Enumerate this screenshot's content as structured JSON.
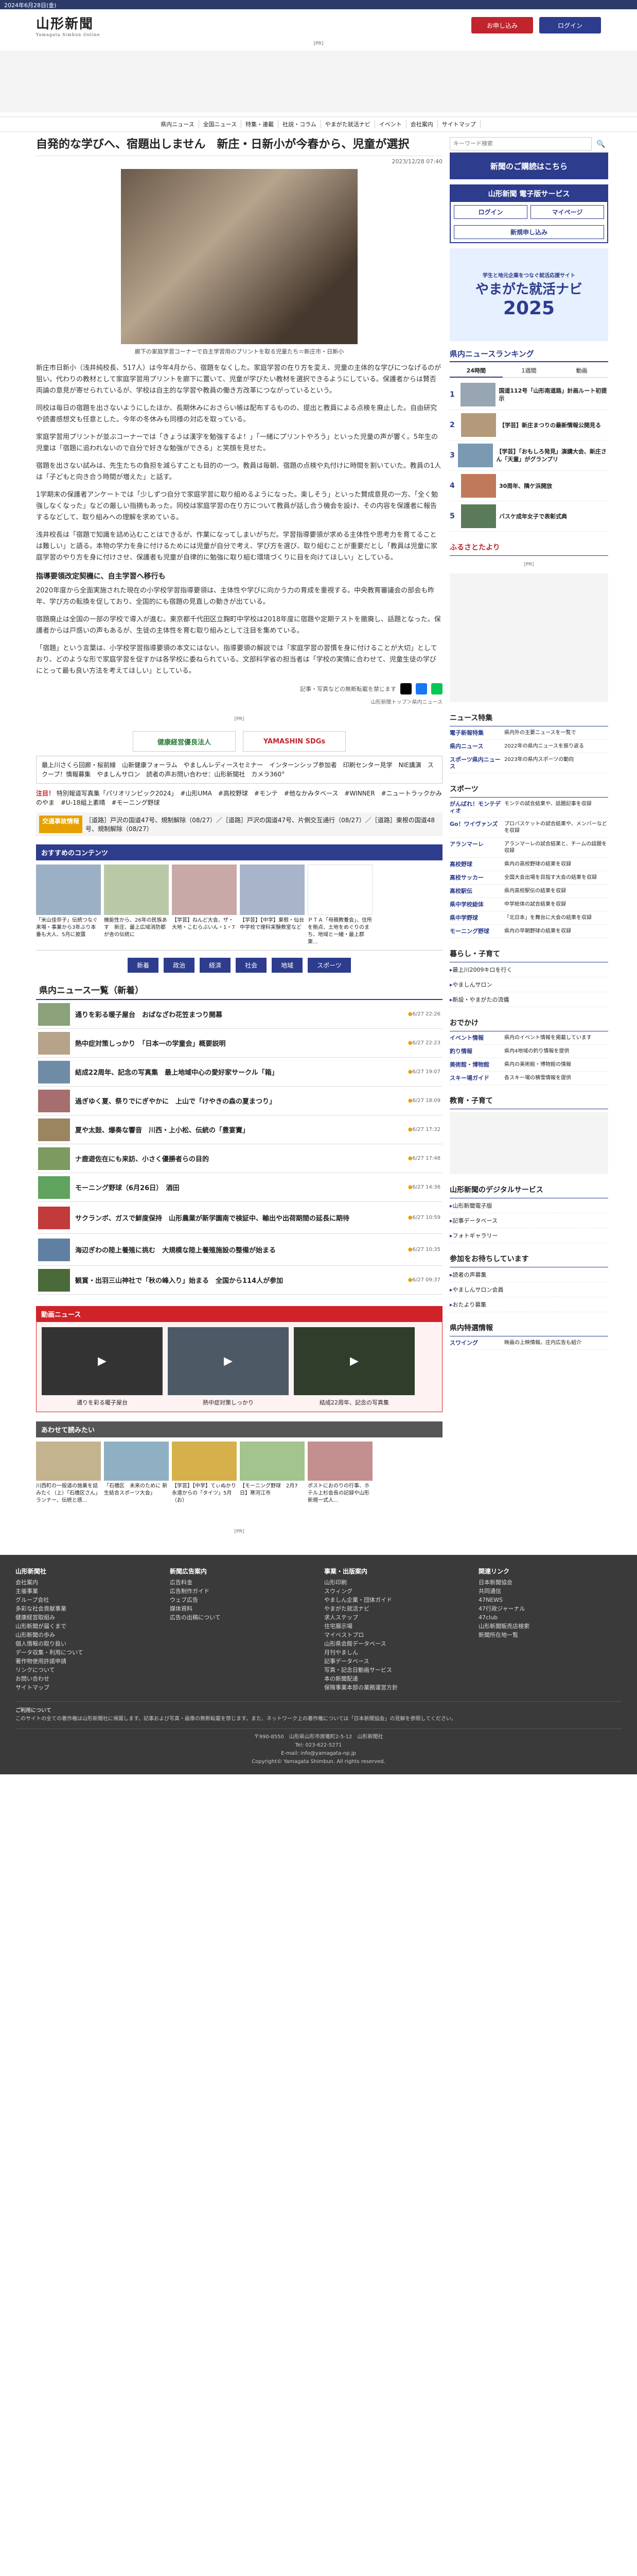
{
  "datebar": "2024年6月28日(金)",
  "header": {
    "logo": "山形新聞",
    "logo_sub": "Yamagata Simbun Online",
    "apply": "お申し込み",
    "login": "ログイン"
  },
  "pr": "[PR]",
  "gnav": [
    "県内ニュース",
    "全国ニュース",
    "特集・連載",
    "社説・コラム",
    "やまがた就活ナビ",
    "イベント",
    "会社案内",
    "サイトマップ"
  ],
  "article": {
    "title": "自発的な学びへ、宿題出しません　新庄・日新小が今春から、児童が選択",
    "date": "2023/12/28 07:40",
    "caption": "廊下の家庭学習コーナーで自主学習用のプリントを取る児童たち＝新庄市・日新小",
    "paragraphs": [
      "新庄市日新小（浅井純校長、517人）は今年4月から、宿題をなくした。家庭学習の在り方を変え、児童の主体的な学びにつなげるのが狙い。代わりの教材として家庭学習用プリントを廊下に置いて、児童が学びたい教材を選択できるようにしている。保護者からは賛否両論の意見が寄せられているが、学校は自主的な学習や教員の働き方改革につながっているという。",
      "同校は毎日の宿題を出さないようにしたほか、長期休みにおさらい帳は配布するものの、提出と教員による点検を廃止した。自由研究や読書感想文も任意とした。今年の冬休みも同様の対応を取っている。",
      "家庭学習用プリントが並ぶコーナーでは「きょうは漢字を勉強するよ！」「一緒にプリントやろう」といった児童の声が響く。5年生の児童は「宿題に追われないので自分で好きな勉強ができる」と笑顔を見せた。",
      "宿題を出さない試みは、先生たちの負担を減らすことも目的の一つ。教員は毎朝、宿題の点検や丸付けに時間を割いていた。教員の1人は「子どもと向き合う時間が増えた」と話す。",
      "1学期末の保護者アンケートでは「少しずつ自分で家庭学習に取り組めるようになった。楽しそう」といった賛成意見の一方、「全く勉強しなくなった」などの厳しい指摘もあった。同校は家庭学習の在り方について教員が話し合う機会を設け、その内容を保護者に報告するなどして、取り組みへの理解を求めている。",
      "浅井校長は「宿題で知識を詰め込むことはできるが、作業になってしまいがちだ。学習指導要領が求める主体性や思考力を育てることは難しい」と語る。本物の学力を身に付けるためには児童が自分で考え、学び方を選び、取り組むことが重要だとし「教員は児童に家庭学習のやり方を身に付けさせ、保護者も児童が自律的に勉強に取り組む環境づくりに目を向けてほしい」としている。"
    ],
    "subhead": "指導要領改定契機に、自主学習へ移行も",
    "paragraphs2": [
      "2020年度から全面実施された現在の小学校学習指導要領は、主体性や学びに向かう力の育成を重視する。中央教育審議会の部会も昨年、学び方の転換を促しており、全国的にも宿題の見直しの動きが出ている。",
      "宿題廃止は全国の一部の学校で導入が進む。東京都千代田区立麹町中学校は2018年度に宿題や定期テストを撤廃し、話題となった。保護者からは戸惑いの声もあるが、生徒の主体性を育む取り組みとして注目を集めている。",
      "「宿題」という言葉は、小学校学習指導要領の本文にはない。指導要領の解説では「家庭学習の習慣を身に付けることが大切」としており、どのような形で家庭学習を促すかは各学校に委ねられている。文部科学省の担当者は「学校の実情に合わせて、児童生徒の学びにとって最も良い方法を考えてほしい」としている。"
    ],
    "share_note": "記事・写真などの無断転載を禁じます",
    "breadcrumb": "山形新聞トップ＞県内ニュース"
  },
  "sponsors": [
    "健康経営優良法人",
    "YAMASHIN SDGs"
  ],
  "related": "最上川さくら回廊・桜前線　山新健康フォーラム　やましんレディースセミナー　インターンシップ参加者　印刷センター見学　NIE講演　スクープ！情報募集　やましんサロン　読者の声お問い合わせ：山形新聞社　カメラ360°",
  "notice": {
    "label": "注目！",
    "text": "特別報道写真集「パリオリンピック2024」　#山形UMA　#高校野球　#モンテ　#他なかみタベース　#WINNER　#ニュートラックかみのやま　#U-18組上素晴　#モーニング野球"
  },
  "ticker": {
    "tag": "交通事故情報",
    "text": "［道路］戸沢の国道47号、規制解除（08/27）／［道路］戸沢の国道47号、片側交互通行（08/27）／［道路］東根の国道48号、規制解除（08/27）"
  },
  "recs_head": "おすすめのコンテンツ",
  "recs": [
    {
      "title": "「米山佳奈子」伝統つなぐ来場・事業から3年ぶり本番も大人、5月に披露"
    },
    {
      "title": "機能性から、26年の民族あす　新庄、最上広域消防都が舎の伝統に"
    },
    {
      "title": "【学芸】ねんど大会、ザ・大地・こむらぶいん・1・7"
    },
    {
      "title": "【学芸】【中学】東根・仙台中学校で理科実験教室など"
    },
    {
      "title": "ＰＴＡ「母親教養会」、住所を拠点、土地をめぐりのまち、地域と一緒・最上郡東..."
    }
  ],
  "cats": [
    "新着",
    "政治",
    "経済",
    "社会",
    "地域",
    "スポーツ"
  ],
  "list_head": "県内ニュース一覧（新着）",
  "news": [
    {
      "title": "通りを彩る暖子屋台　おばなざわ花笠まつり開幕",
      "ts": "6/27 22:26"
    },
    {
      "title": "熱中症対策しっかり　「日本一の学童会」概要説明",
      "ts": "6/27 22:23"
    },
    {
      "title": "結成22周年、記念の写真集　最上地域中心の愛好家サークル「箱」",
      "ts": "6/27 19:07"
    },
    {
      "title": "過ぎゆく夏、祭りでにぎやかに　上山で「けやきの森の夏まつり」",
      "ts": "6/27 18:09"
    },
    {
      "title": "夏や太鼓、爆奏な響音　川西・上小松、伝統の「豊宴寶」",
      "ts": "6/27 17:32"
    },
    {
      "title": "ナ鹿遊佐在にも来訪、小さく優勝者らの目的",
      "ts": "6/27 17:48"
    },
    {
      "title": "モーニング野球（6月26日）　酒田",
      "ts": "6/27 14:36"
    },
    {
      "title": "サクランボ、ガスで鮮度保持　山形農業が新学園南で検証中、輸出や出荷期間の延長に期待",
      "ts": "6/27 10:59"
    },
    {
      "title": "海辺ぎわの陸上養殖に挑む　大規模な陸上養殖施設の整備が始まる",
      "ts": "6/27 10:35"
    },
    {
      "title": "観賞・出羽三山神社で「秋の峰入り」始まる　全国から114人が参加",
      "ts": "6/27 09:37"
    }
  ],
  "video_head": "動画ニュース",
  "videos": [
    {
      "title": "通りを彩る暖子屋台"
    },
    {
      "title": "熱中症対策しっかり"
    },
    {
      "title": "結成22周年、記念の写真集"
    }
  ],
  "also_head": "あわせて読みたい",
  "also": [
    {
      "title": "川西町の一般道の施業を詰みたく（上）「石橋区さん」ランナー、伝統と感..."
    },
    {
      "title": "「石橋区　未来のために 新生結合スポーツ大会」"
    },
    {
      "title": "【学芸】【中学】てぃぬかり永遠からの「タイツ」5月（お）"
    },
    {
      "title": "【モーニング野球　2月7日】寒河江市"
    },
    {
      "title": "ポストにおのりの行事、ホテル上杉会長の記録や山形新規一式人..."
    }
  ],
  "side": {
    "search_placeholder": "キーワード検索",
    "banner1": "新聞のご購読はこちら",
    "navi_title": "山形新聞 電子版サービス",
    "navi_btns": [
      "ログイン",
      "マイページ",
      "新規申し込み"
    ],
    "shukatsu_pre": "学生と地元企業をつなぐ就活応援サイト",
    "shukatsu": "やまがた就活ナビ",
    "shukatsu_year": "2025",
    "rank_head": "県内ニュースランキング",
    "rank_tabs": [
      "24時間",
      "1週間",
      "動画"
    ],
    "ranks": [
      {
        "n": "1",
        "title": "国道112号「山形南道路」計画ルート初提示"
      },
      {
        "n": "2",
        "title": "【学芸】新庄まつりの最新情報公開見る"
      },
      {
        "n": "3",
        "title": "【学芸】「おもしろ発見」演講大会、新庄さん「天童」がグランプリ"
      },
      {
        "n": "4",
        "title": "30周年、隣ケ浜開放"
      },
      {
        "n": "5",
        "title": "バスケ成年女子で表彰式典"
      }
    ],
    "furusato": "ふるさとたより",
    "special_head": "ニュース特集",
    "specials": [
      {
        "logo": "電子新報特集",
        "text": "県内外の主要ニュースを一覧で"
      },
      {
        "logo": "県内ニュース",
        "text": "2022年の県内ニュースを振り返る"
      },
      {
        "logo": "スポーツ県内ニュース",
        "text": "2023年の県内スポーツの動向"
      }
    ],
    "sports_head": "スポーツ",
    "sports": [
      {
        "logo": "がんばれ！モンテディオ",
        "text": "モンテの試合結果や、話題記事を収録"
      },
      {
        "logo": "Go！ワイヴァンズ",
        "text": "プロバスケットの試合結果や、メンバーなどを収録"
      },
      {
        "logo": "アランマーレ",
        "text": "アランマーレの試合結果と、チームの話題を収録"
      },
      {
        "logo": "高校野球",
        "text": "県内の高校野球の結果を収録"
      },
      {
        "logo": "高校サッカー",
        "text": "全国大会出場を目指す大会の結果を収録"
      },
      {
        "logo": "高校駅伝",
        "text": "県内高校駅伝の結果を収録"
      },
      {
        "logo": "県中学校総体",
        "text": "中学総体の試合結果を収録"
      },
      {
        "logo": "県中学野球",
        "text": "「北日本」を舞台に大会の結果を収録"
      },
      {
        "logo": "モーニング野球",
        "text": "県内の早朝野球の結果を収録"
      }
    ],
    "life_head": "暮らし・子育て",
    "life": [
      "最上川2009キロを行く",
      "やましんサロン",
      "新設・やまがたの流儀"
    ],
    "odekake_head": "おでかけ",
    "odekake": [
      {
        "logo": "イベント情報",
        "text": "県内のイベント情報を掲載しています"
      },
      {
        "logo": "釣り情報",
        "text": "県内4地域の釣り情報を提供"
      },
      {
        "logo": "美術館・博物館",
        "text": "県内の美術館・博物館の情報"
      },
      {
        "logo": "スキー場ガイド",
        "text": "各スキー場の積雪情報を提供"
      }
    ],
    "edu_head": "教育・子育て",
    "digital_head": "山形新聞のデジタルサービス",
    "digital": [
      "山形新聞電子版",
      "記事データベース",
      "フォトギャラリー"
    ],
    "join_head": "参加をお待ちしています",
    "join": [
      "読者の声募集",
      "やましんサロン会員",
      "おたより募集"
    ],
    "weather_head": "県内特選情報",
    "weather": {
      "logo": "スワイング",
      "text": "映画の上映情報。庄内広告も紹介"
    }
  },
  "footer": {
    "cols": [
      {
        "head": "山形新聞社",
        "items": [
          "会社案内",
          "主催事業",
          "グループ会社",
          "多彩な社会貢献事業",
          "健康経営取組み",
          "山形新聞が届くまで",
          "山形新聞の歩み",
          "個人情報の取り扱い",
          "データ収集・利用について",
          "著作物使用許諾申請",
          "リンクについて",
          "お問い合わせ",
          "サイトマップ"
        ]
      },
      {
        "head": "新聞広告案内",
        "items": [
          "広告料金",
          "広告制作ガイド",
          "ウェブ広告",
          "媒体資料",
          "広告の出稿について"
        ]
      },
      {
        "head": "事業・出版案内",
        "items": [
          "山形印刷",
          "スウィング",
          "やましん企業・団体ガイド",
          "やまがた就活ナビ",
          "求人ステップ",
          "住宅展示場",
          "マイベストプロ",
          "山形県会館データベース",
          "月刊やましん",
          "記事データベース",
          "写真・記念日動画サービス",
          "本の新聞配達",
          "保険事業本部の業務運営方針"
        ]
      },
      {
        "head": "関連リンク",
        "items": [
          "日本新聞協会",
          "共同通信",
          "47NEWS",
          "47行政ジャーナル",
          "47club",
          "山形新聞販売店検索",
          "新聞所在地一覧"
        ]
      }
    ],
    "note_label": "ご利用について",
    "note": "このサイトの全ての著作権は山形新聞社に帰属します。記事および写真・画像の無断転載を禁じます。また、ネットワーク上の著作権については「日本新聞協会」の見解を参照してください。",
    "address": "〒990-8550　山形県山形市旅篭町2-5-12　山形新聞社",
    "tel": "Tel: 023-622-5271",
    "email": "E-mail: info@yamagata-np.jp",
    "copy": "Copyright© Yamagata Shimbun. All rights reserved."
  },
  "colors": {
    "navy": "#2d3c8c",
    "red": "#c0252d",
    "accent": "#e6a100"
  }
}
